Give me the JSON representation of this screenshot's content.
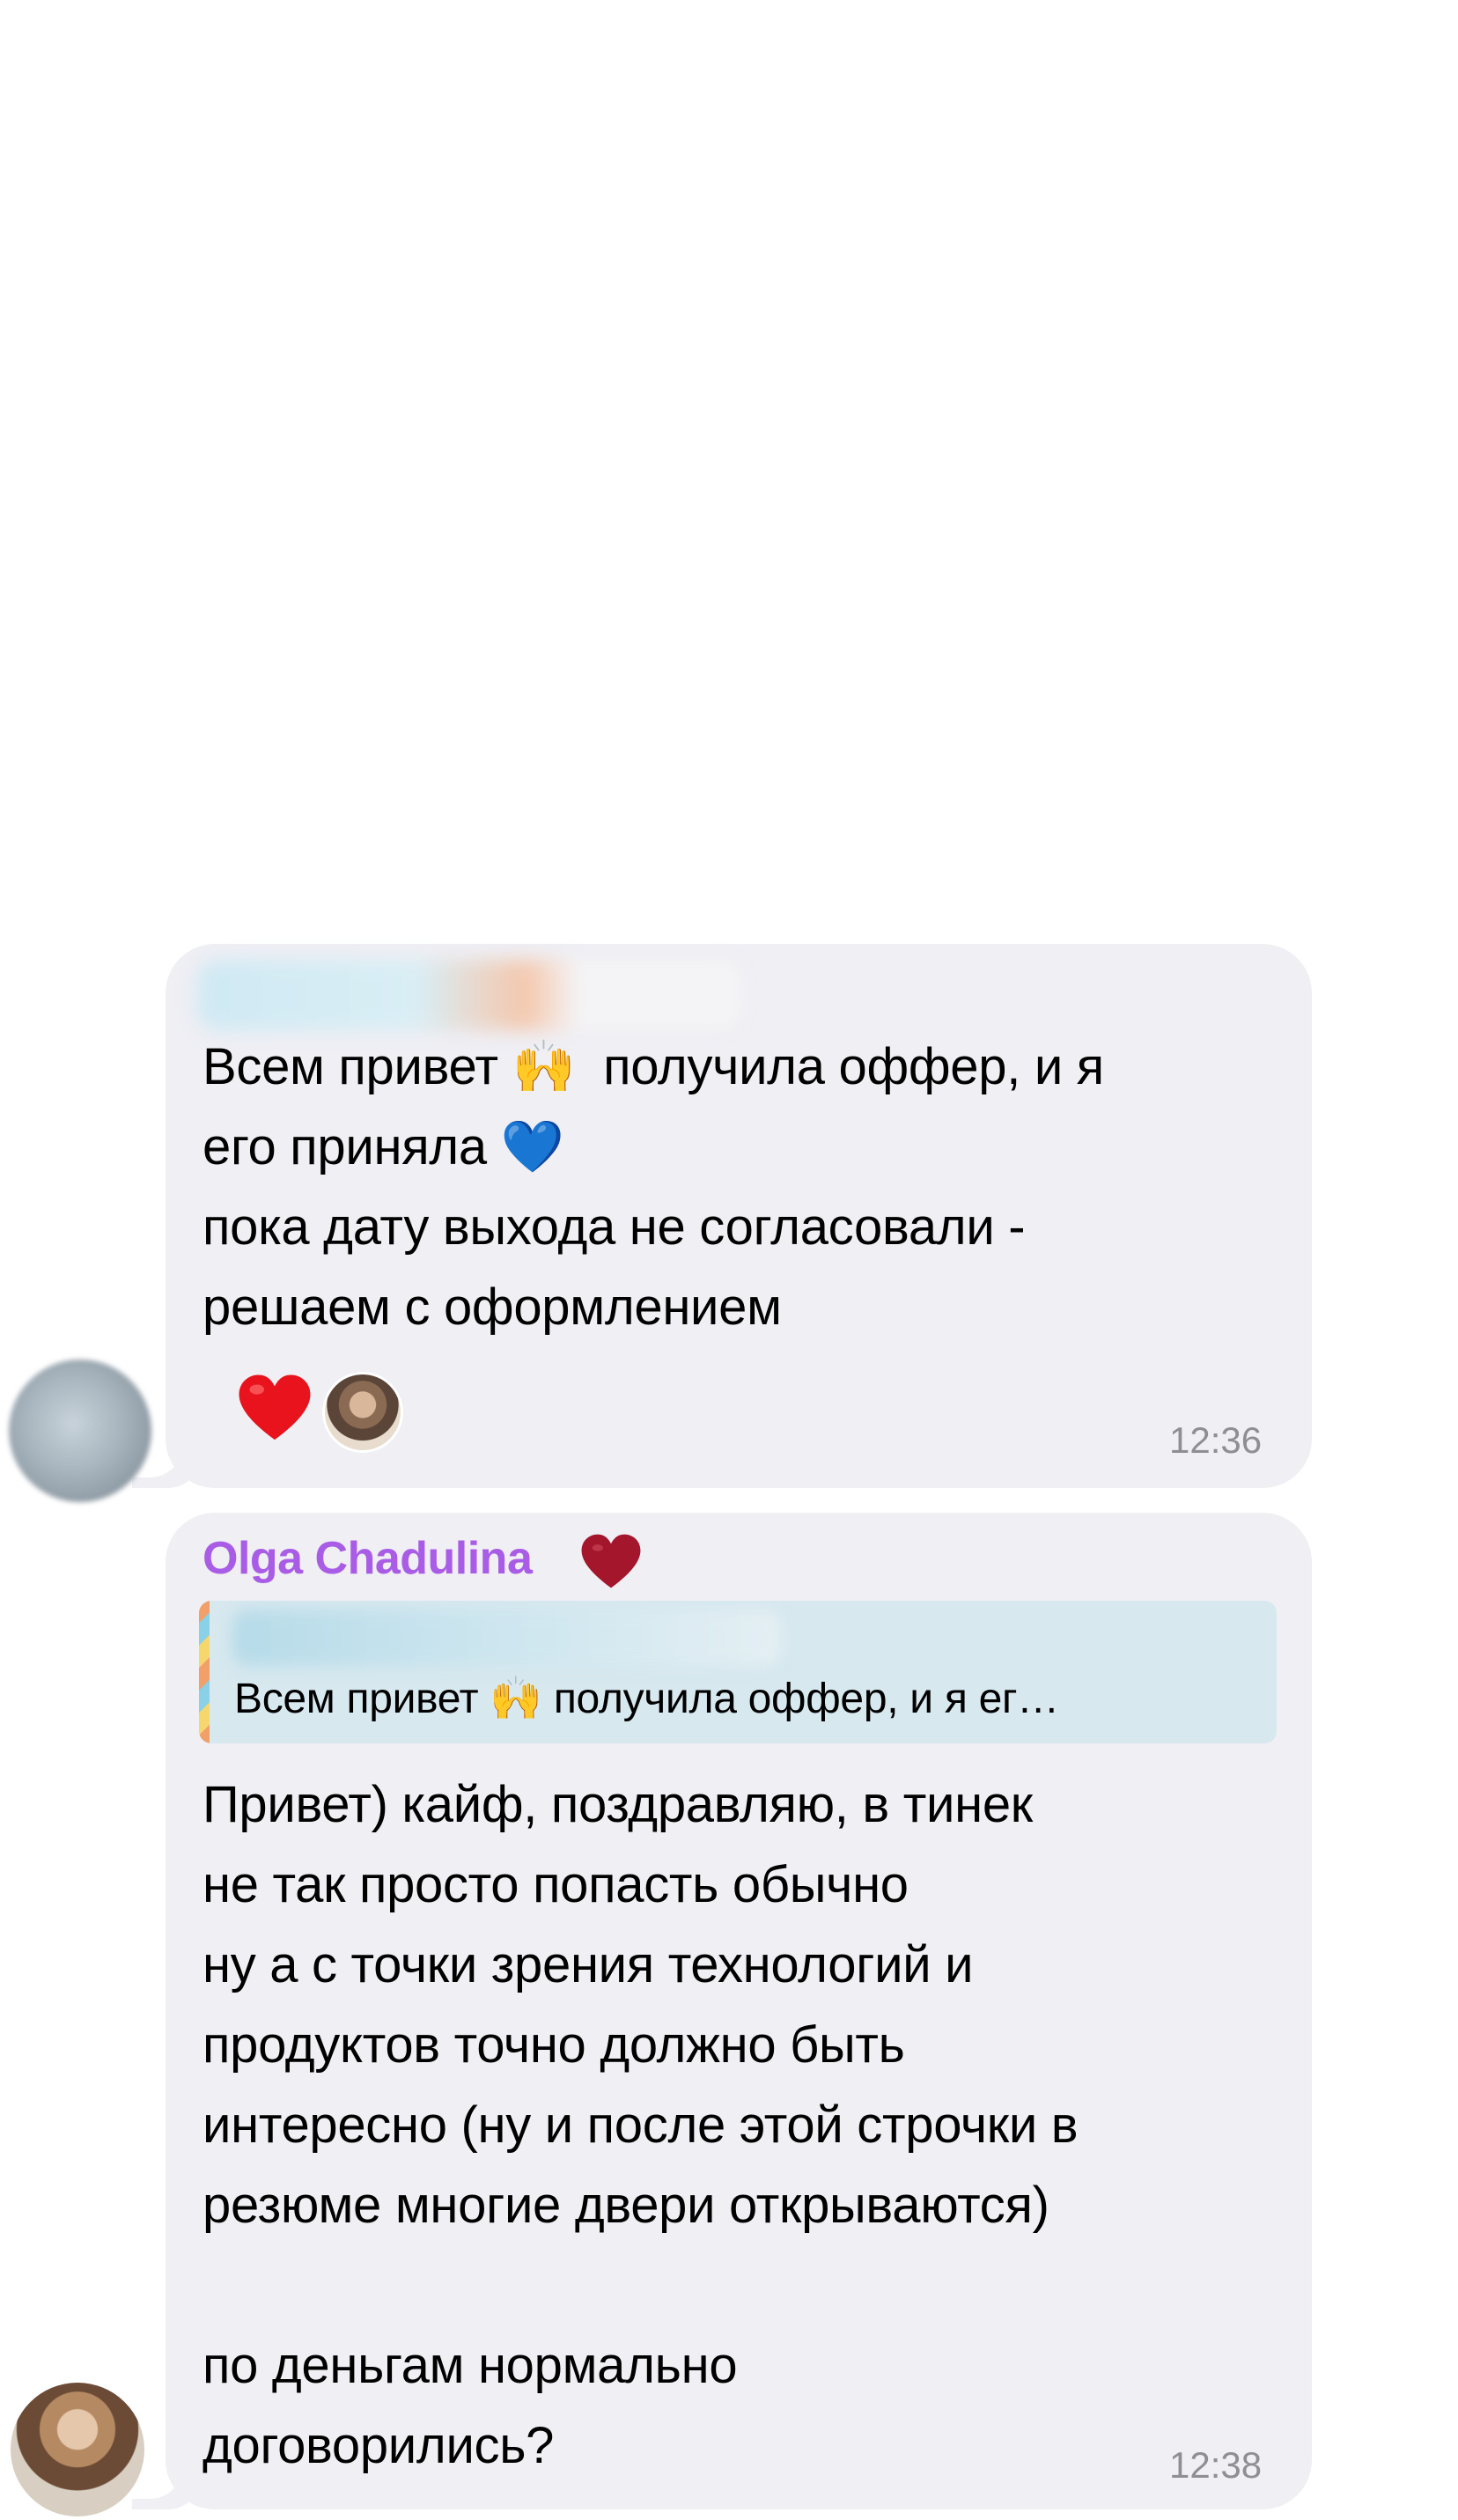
{
  "messages": [
    {
      "text_line1_a": "Всем привет ",
      "text_line1_emoji": "🙌",
      "text_line1_b": "  получила оффер, и я",
      "text_line2_a": "его приняла ",
      "text_line2_emoji": "💙",
      "text_rest": "пока дату выхода не согласовали -\nрешаем с оформлением",
      "reactions": [
        {
          "icon": "red-heart-icon",
          "color": "#e8131c"
        },
        {
          "icon": "reactor-avatar"
        }
      ],
      "time": "12:36"
    },
    {
      "sender": "Olga Chadulina",
      "sender_color": "#a95ce6",
      "sender_badge_icon": "dark-red-heart-icon",
      "reply_preview_a": "Всем привет ",
      "reply_preview_emoji": "🙌",
      "reply_preview_b": " получила оффер, и я ег…",
      "text": "Привет) кайф, поздравляю, в тинек\nне так просто попасть обычно\nну а с точки зрения технологий и\nпродуктов точно должно быть\nинтересно (ну и после этой строчки в\nрезюме многие двери открываются)\n\nпо деньгам нормально\nдоговорились?",
      "time": "12:38"
    }
  ]
}
